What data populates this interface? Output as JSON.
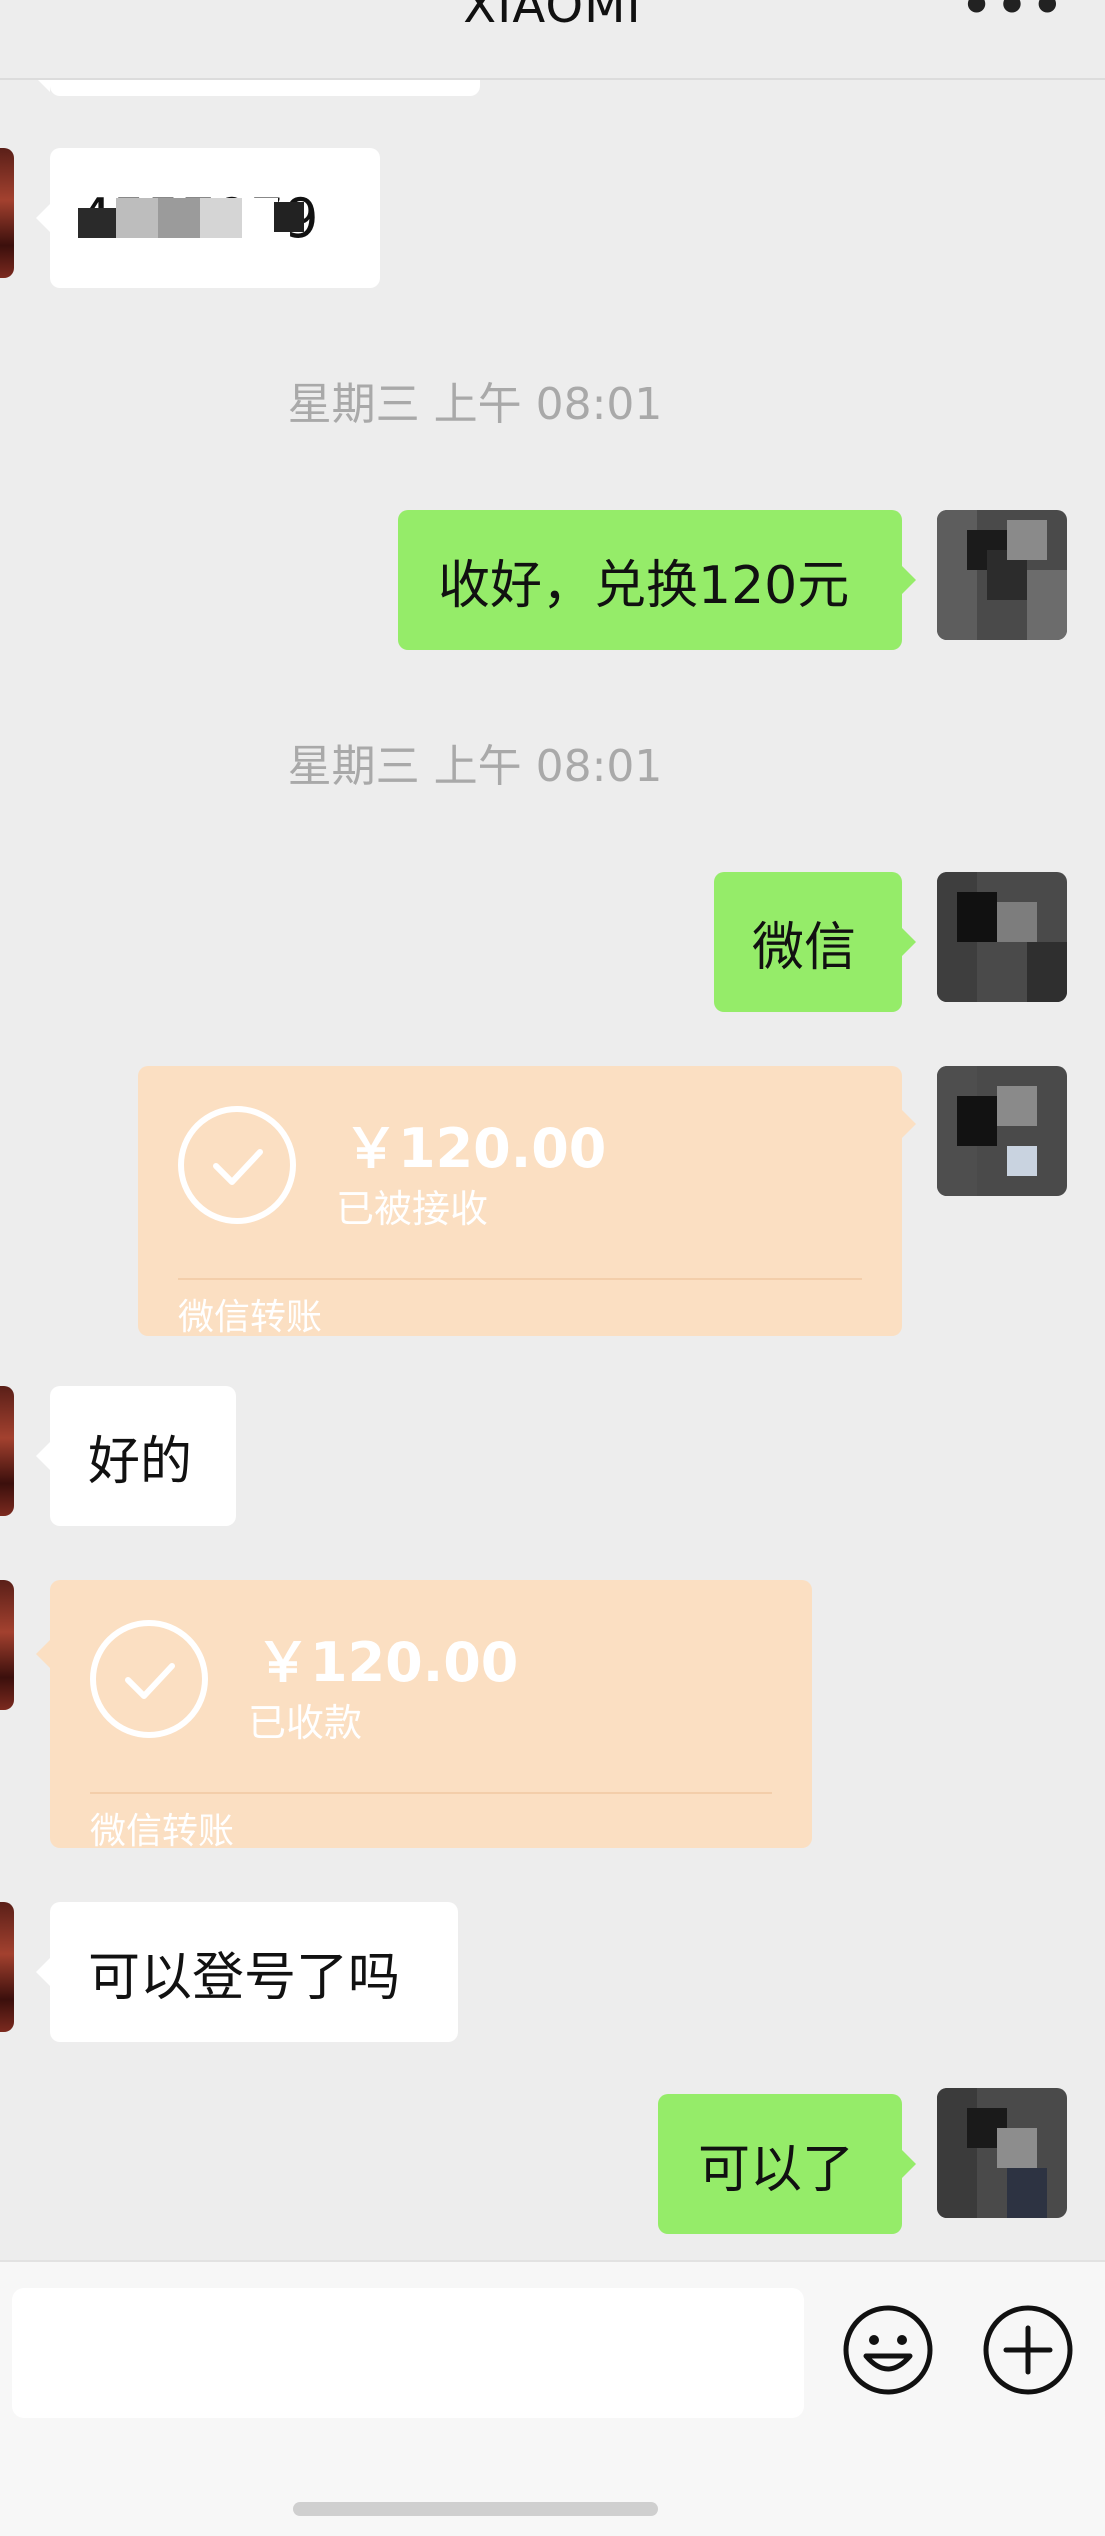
{
  "header": {
    "title": "XIAOMI",
    "more": "•••"
  },
  "messages": {
    "m1_text": "4557979",
    "stamp1": "星期三 上午 08:01",
    "m2_text": "收好，兑换120元",
    "stamp2": "星期三 上午 08:01",
    "m3_text": "微信",
    "transfer_out": {
      "amount": "￥120.00",
      "status": "已被接收",
      "footer": "微信转账"
    },
    "m4_text": "好的",
    "transfer_in": {
      "amount": "￥120.00",
      "status": "已收款",
      "footer": "微信转账"
    },
    "m5_text": "可以登号了吗",
    "m6_text": "可以了"
  },
  "bottom": {
    "emoji_icon": "smiley-icon",
    "plus_icon": "plus-circle-icon"
  },
  "colors": {
    "background": "#ededed",
    "green_bubble": "#95ec69",
    "transfer": "#fbdfc2"
  }
}
